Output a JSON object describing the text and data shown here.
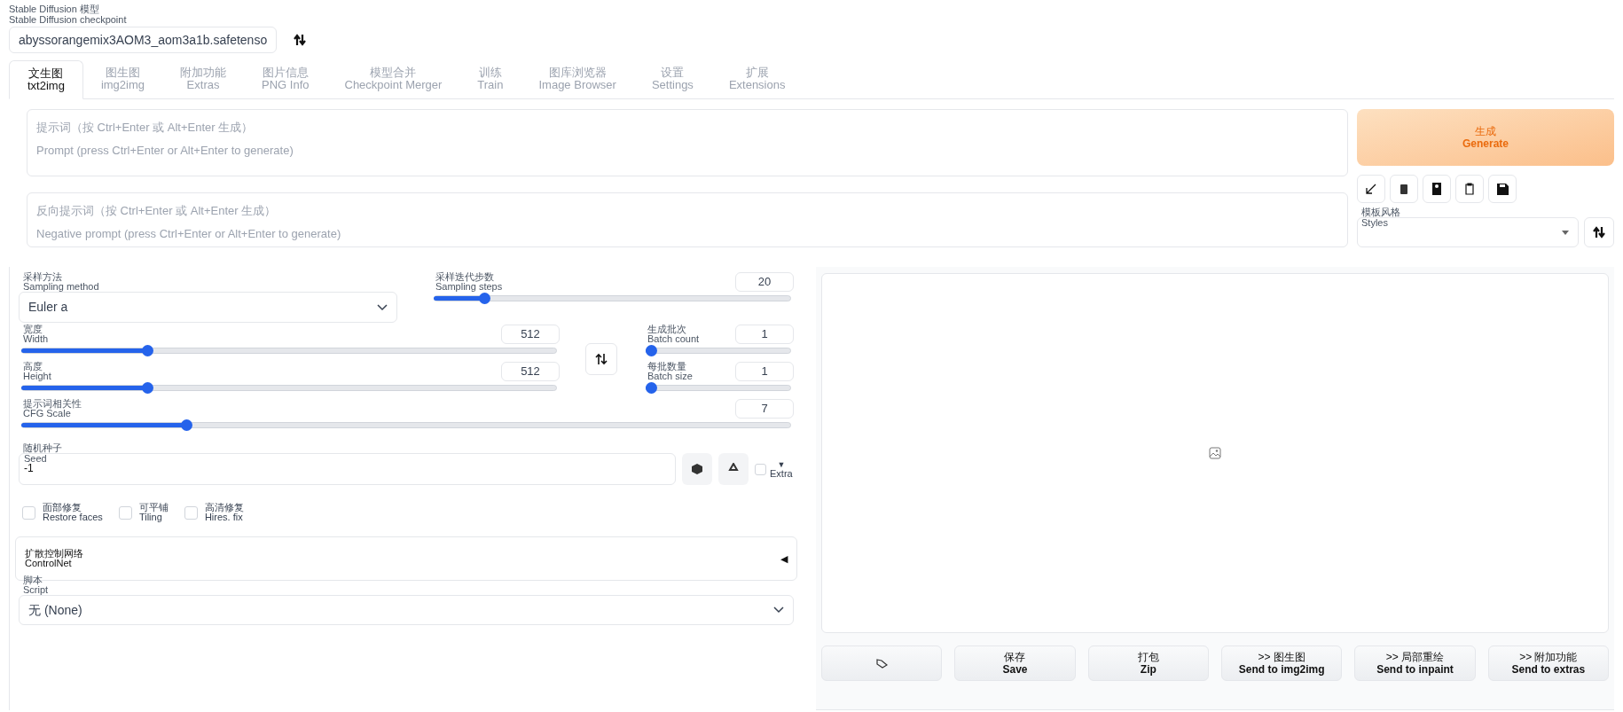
{
  "checkpoint": {
    "label": "Stable Diffusion 模型",
    "label_en": "Stable Diffusion checkpoint",
    "value": "abyssorangemix3AOM3_aom3a1b.safetenso"
  },
  "tabs": [
    {
      "label": "文生图",
      "label_en": "txt2img",
      "selected": true
    },
    {
      "label": "图生图",
      "label_en": "img2img",
      "selected": false
    },
    {
      "label": "附加功能",
      "label_en": "Extras",
      "selected": false
    },
    {
      "label": "图片信息",
      "label_en": "PNG Info",
      "selected": false
    },
    {
      "label": "模型合并",
      "label_en": "Checkpoint Merger",
      "selected": false
    },
    {
      "label": "训练",
      "label_en": "Train",
      "selected": false
    },
    {
      "label": "图库浏览器",
      "label_en": "Image Browser",
      "selected": false
    },
    {
      "label": "设置",
      "label_en": "Settings",
      "selected": false
    },
    {
      "label": "扩展",
      "label_en": "Extensions",
      "selected": false
    }
  ],
  "prompt": {
    "placeholder": "提示词（按 Ctrl+Enter 或 Alt+Enter 生成）",
    "placeholder_en": "Prompt (press Ctrl+Enter or Alt+Enter to generate)"
  },
  "negative_prompt": {
    "placeholder": "反向提示词（按 Ctrl+Enter 或 Alt+Enter 生成）",
    "placeholder_en": "Negative prompt (press Ctrl+Enter or Alt+Enter to generate)"
  },
  "generate": {
    "label": "生成",
    "label_en": "Generate"
  },
  "styles": {
    "label": "模板风格",
    "label_en": "Styles"
  },
  "sampling_method": {
    "label": "采样方法",
    "label_en": "Sampling method",
    "value": "Euler a"
  },
  "sliders": [
    {
      "label": "采样迭代步数",
      "label_en": "Sampling steps",
      "value": "20",
      "level": 0.13
    },
    {
      "label": "宽度",
      "label_en": "Width",
      "value": "512",
      "level": 0.23
    },
    {
      "label": "生成批次",
      "label_en": "Batch count",
      "value": "1",
      "level": 0
    },
    {
      "label": "高度",
      "label_en": "Height",
      "value": "512",
      "level": 0.23
    },
    {
      "label": "每批数量",
      "label_en": "Batch size",
      "value": "1",
      "level": 0
    },
    {
      "label": "提示词相关性",
      "label_en": "CFG Scale",
      "value": "7",
      "level": 0.21
    }
  ],
  "seed": {
    "label": "随机种子",
    "label_en": "Seed",
    "value": "-1",
    "extra": {
      "checked": false,
      "arrow": "▼",
      "label": "Extra"
    }
  },
  "options": [
    {
      "label": "面部修复",
      "label_en": "Restore faces",
      "checked": false
    },
    {
      "label": "可平铺",
      "label_en": "Tiling",
      "checked": false
    },
    {
      "label": "高清修复",
      "label_en": "Hires. fix",
      "checked": false
    }
  ],
  "controlnet": {
    "label": "扩散控制网络",
    "label_en": "ControlNet",
    "toggle": "◀"
  },
  "script": {
    "label": "脚本",
    "label_en": "Script",
    "value": "无 (None)"
  },
  "output_buttons": [
    {
      "label": "保存",
      "label_en": "Save"
    },
    {
      "label": "打包",
      "label_en": "Zip"
    },
    {
      "label": ">> 图生图",
      "label_en": "Send to img2img"
    },
    {
      "label": ">> 局部重绘",
      "label_en": "Send to inpaint"
    },
    {
      "label": ">> 附加功能",
      "label_en": "Send to extras"
    }
  ]
}
